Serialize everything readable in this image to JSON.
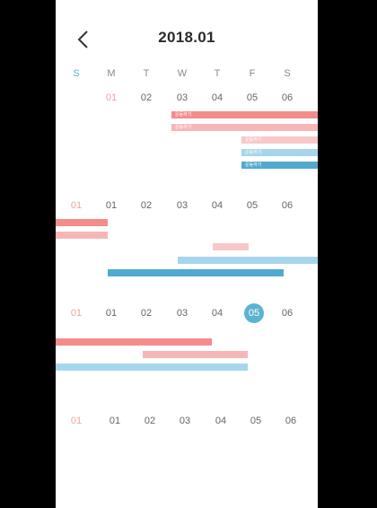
{
  "header": {
    "month": "2018.01"
  },
  "weekdays": [
    "S",
    "M",
    "T",
    "W",
    "T",
    "F",
    "S"
  ],
  "weeks": [
    {
      "days": [
        "",
        "01",
        "02",
        "03",
        "04",
        "05",
        "06"
      ]
    },
    {
      "days": [
        "01",
        "01",
        "02",
        "03",
        "04",
        "05",
        "06"
      ]
    },
    {
      "days": [
        "01",
        "01",
        "02",
        "03",
        "04",
        "05",
        "06"
      ],
      "selected_day": "05"
    },
    {
      "days": [
        "01",
        "01",
        "02",
        "03",
        "04",
        "05",
        "06"
      ]
    }
  ],
  "events": {
    "week1": [
      "운동하기",
      "운동하기",
      "운동하기",
      "운동하기",
      "운동하기"
    ]
  },
  "colors": {
    "event_red": "#f48c8c",
    "event_pink": "#f7b6b6",
    "event_blue": "#a6d6ee",
    "event_teal": "#51a9cf",
    "selected": "#5ab3d3"
  }
}
